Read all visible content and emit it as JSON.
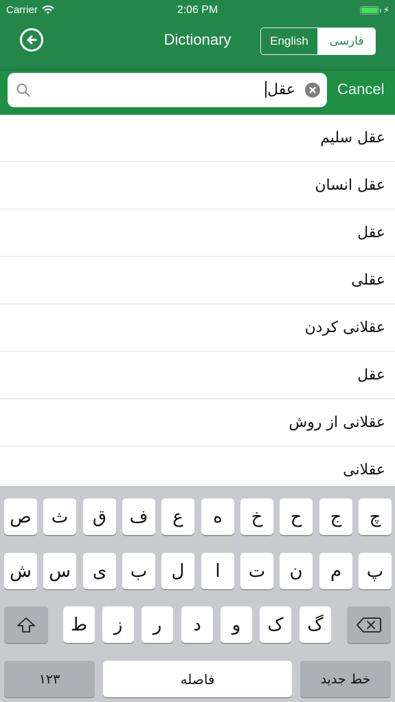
{
  "status_bar": {
    "carrier": "Carrier",
    "time": "2:06 PM",
    "wifi_icon": "wifi-icon",
    "battery_icon": "battery-charging-icon"
  },
  "nav": {
    "back_icon": "arrow-left-circle-icon",
    "title": "Dictionary",
    "language_toggle": {
      "options": [
        "English",
        "فارسی"
      ],
      "selected": "فارسی"
    }
  },
  "search": {
    "value": "عقل",
    "search_icon": "search-icon",
    "clear_icon": "clear-icon",
    "cancel_label": "Cancel"
  },
  "results": [
    "عقل سلیم",
    "عقل انسان",
    "عقل",
    "عقلی",
    "عقلانی کردن",
    "عقل",
    "عقلانی از روش",
    "عقلانی"
  ],
  "keyboard": {
    "row1": [
      "ص",
      "ث",
      "ق",
      "ف",
      "ع",
      "ه",
      "خ",
      "ح",
      "ج",
      "چ"
    ],
    "row2": [
      "ش",
      "س",
      "ی",
      "ب",
      "ل",
      "ا",
      "ت",
      "ن",
      "م",
      "پ"
    ],
    "row3": [
      "ط",
      "ز",
      "ر",
      "د",
      "و",
      "ک",
      "گ"
    ],
    "shift_icon": "shift-icon",
    "backspace_icon": "backspace-icon",
    "numbers_label": "۱۲۳",
    "space_label": "فاصله",
    "return_label": "خط جدید"
  },
  "colors": {
    "primary_green": "#23874a",
    "search_bar_green": "#1f8f45",
    "keyboard_bg": "#c9cacf"
  }
}
